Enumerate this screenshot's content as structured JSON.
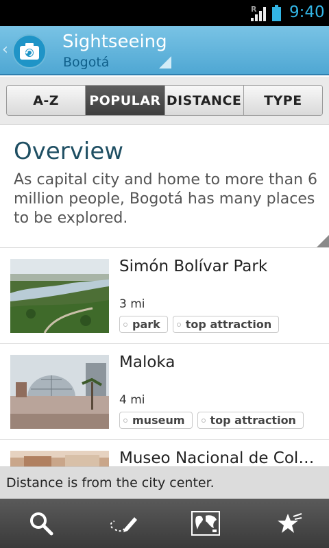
{
  "status_bar": {
    "time": "9:40",
    "roaming": "R"
  },
  "action_bar": {
    "title": "Sightseeing",
    "subtitle": "Bogotá",
    "app_icon": "camera-icon"
  },
  "tabs": [
    {
      "label": "A-Z",
      "active": false
    },
    {
      "label": "POPULAR",
      "active": true
    },
    {
      "label": "DISTANCE",
      "active": false
    },
    {
      "label": "TYPE",
      "active": false
    }
  ],
  "overview": {
    "title": "Overview",
    "text": "As capital city and home to more than 6 million people, Bogotá has many places to be explored."
  },
  "items": [
    {
      "name": "Simón Bolívar Park",
      "distance": "3 mi",
      "tags": [
        "park",
        "top attraction"
      ]
    },
    {
      "name": "Maloka",
      "distance": "4 mi",
      "tags": [
        "museum",
        "top attraction"
      ]
    },
    {
      "name": "Museo Nacional de Colo…",
      "distance": "",
      "tags": []
    }
  ],
  "toast": "Distance is from the city center.",
  "bottom_nav": [
    {
      "icon": "search-icon"
    },
    {
      "icon": "pencil-icon"
    },
    {
      "icon": "map-icon"
    },
    {
      "icon": "favorites-star-icon"
    }
  ]
}
